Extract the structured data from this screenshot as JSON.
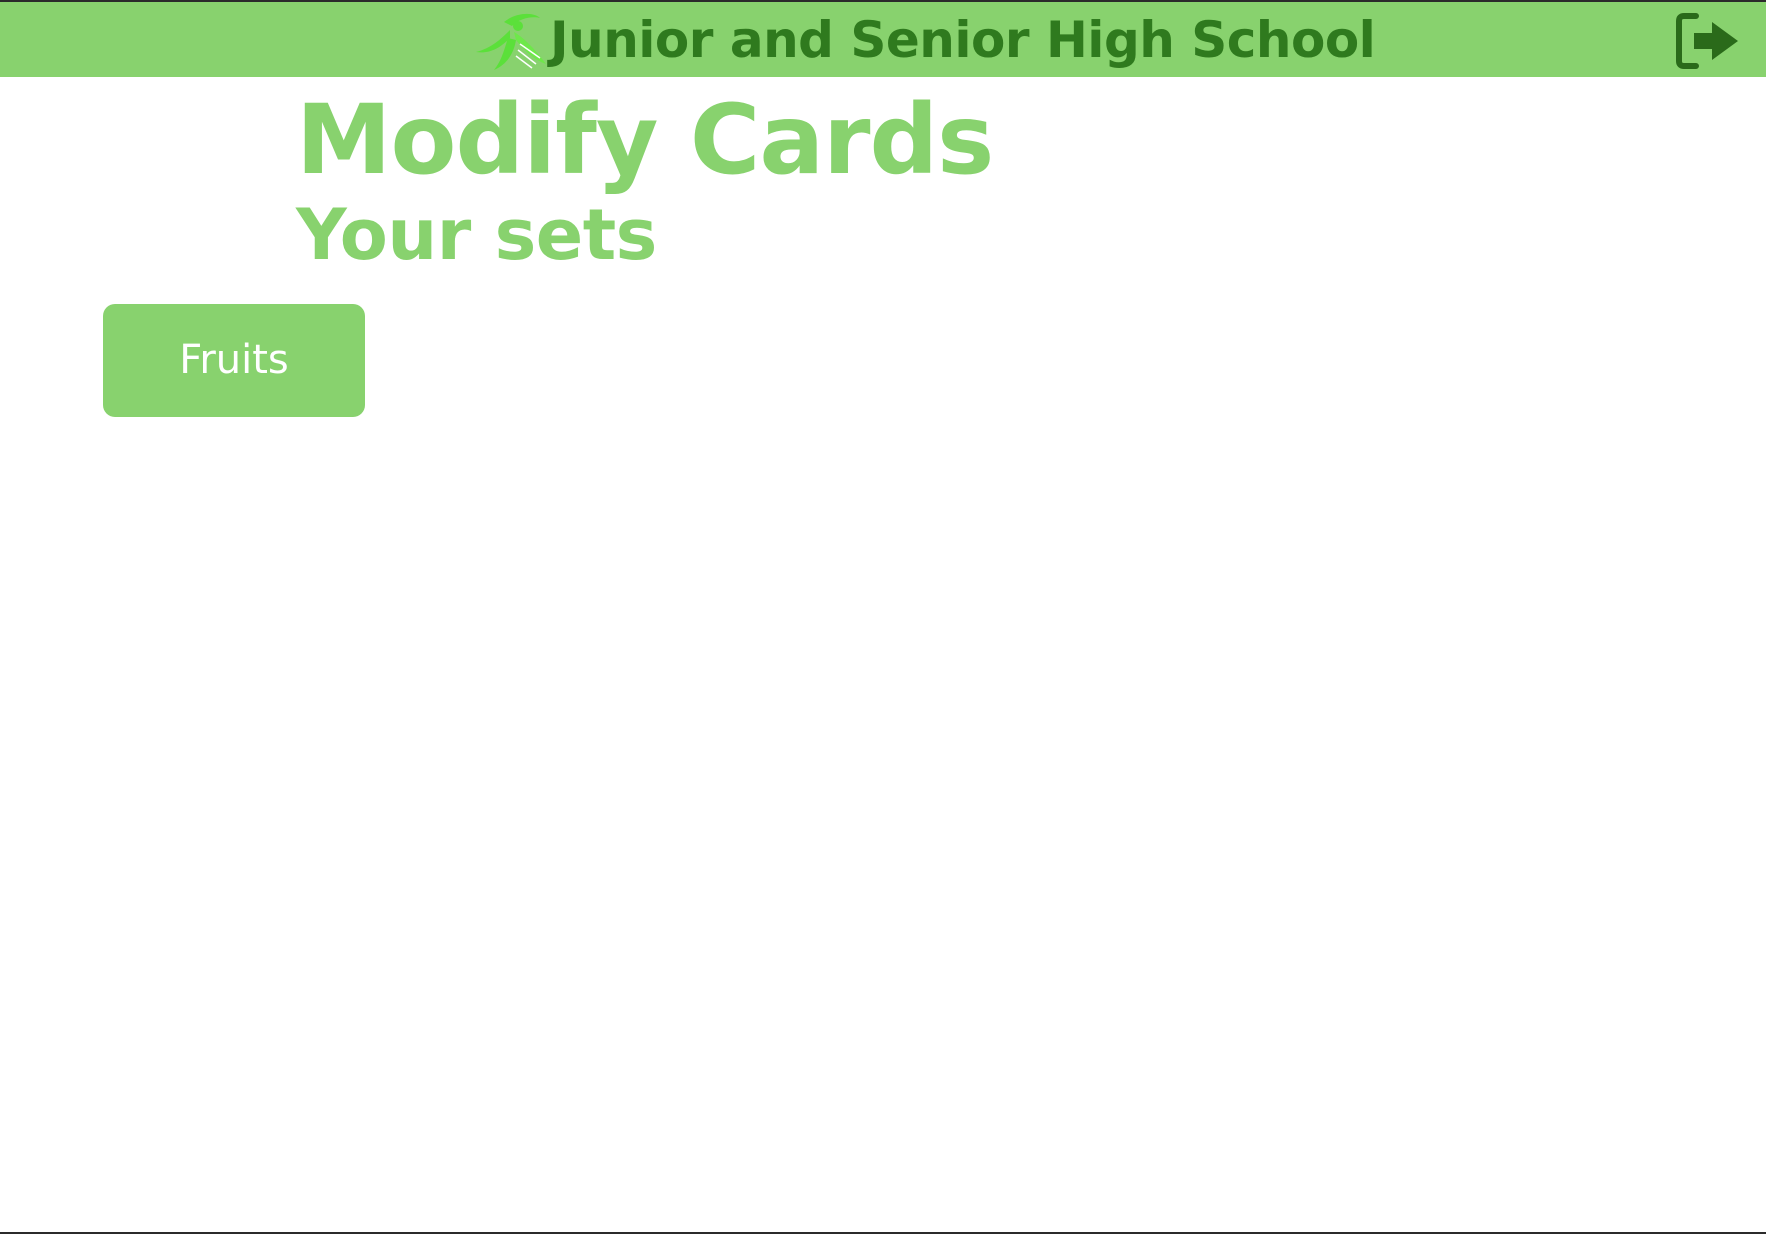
{
  "header": {
    "school_name": "Junior and Senior High School",
    "logo_icon": "school-logo-icon",
    "logout_icon": "sign-out-icon"
  },
  "main": {
    "title": "Modify Cards",
    "section_title": "Your sets",
    "sets": [
      {
        "label": "Fruits"
      }
    ]
  },
  "colors": {
    "accent": "#88d26e",
    "header_text": "#2f7a1e",
    "logo_green": "#5be03a",
    "logout_icon": "#2a6a1a",
    "button_text": "#ffffff"
  }
}
